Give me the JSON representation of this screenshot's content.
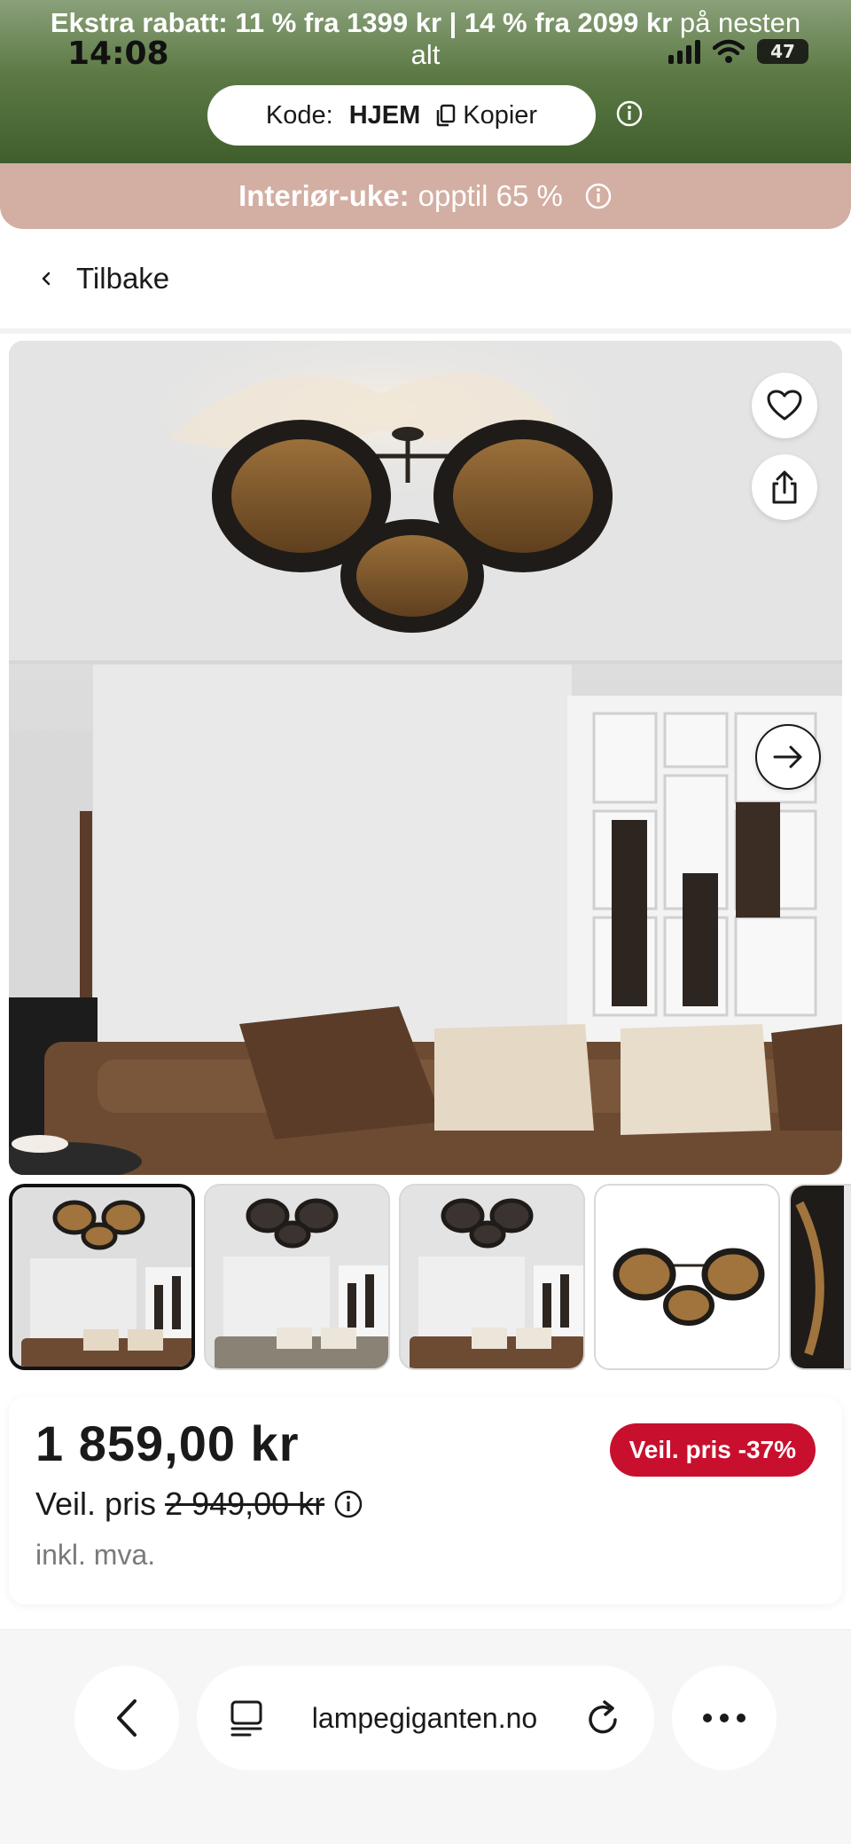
{
  "status_bar": {
    "time": "14:08",
    "battery": "47"
  },
  "promo": {
    "headline_bold": "Ekstra rabatt: 11 % fra 1399 kr | 14 % fra 2099 kr",
    "headline_rest": " på nesten alt",
    "code_label": "Kode:",
    "code_value": "HJEM",
    "copy_label": "Kopier"
  },
  "sale_bar": {
    "bold": "Interiør-uke:",
    "rest": "opptil 65 %"
  },
  "back": {
    "label": "Tilbake"
  },
  "price": {
    "current": "1 859,00 kr",
    "badge": "Veil. pris -37%",
    "recommended_label": "Veil. pris",
    "recommended_value": "2 949,00 kr",
    "vat_note": "inkl. mva."
  },
  "browser": {
    "url": "lampegiganten.no"
  },
  "colors": {
    "promo_green": "#4f6e3a",
    "sale_pink": "#d3aea2",
    "badge_red": "#c8102e"
  },
  "icons": {
    "heart": "heart-icon",
    "share": "share-icon",
    "next": "arrow-right-icon",
    "info": "info-icon",
    "copy": "copy-icon",
    "back": "chevron-left-icon",
    "tabs": "tabs-icon",
    "reload": "reload-icon",
    "more": "more-icon"
  }
}
